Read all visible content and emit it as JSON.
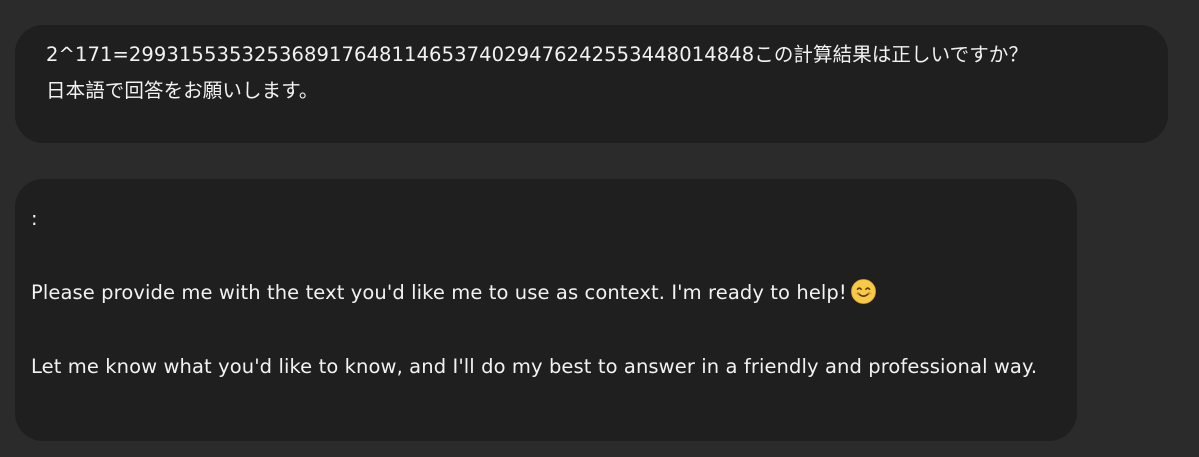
{
  "user_message": {
    "line1": "2^171=2993155353253689176481146537402947624255344801484 8この計算結果は正しいですか？",
    "line1_clean": "2^171=29931553532536891764811465374029476242553448014848この計算結果は正しいですか？",
    "line2": "日本語で回答をお願いします。"
  },
  "assistant_message": {
    "prefix": ":",
    "paragraph1": "Please provide me with the text you'd like me to use as context. I'm ready to help!",
    "emoji_icon": "smiling-face-icon",
    "paragraph2": "Let me know what you'd like to know, and I'll do my best to answer in a friendly and professional way."
  },
  "colors": {
    "page_background": "#2b2b2b",
    "bubble_background": "#1f1f1f",
    "text": "#f2f2f2",
    "emoji_face": "#f7c948"
  }
}
